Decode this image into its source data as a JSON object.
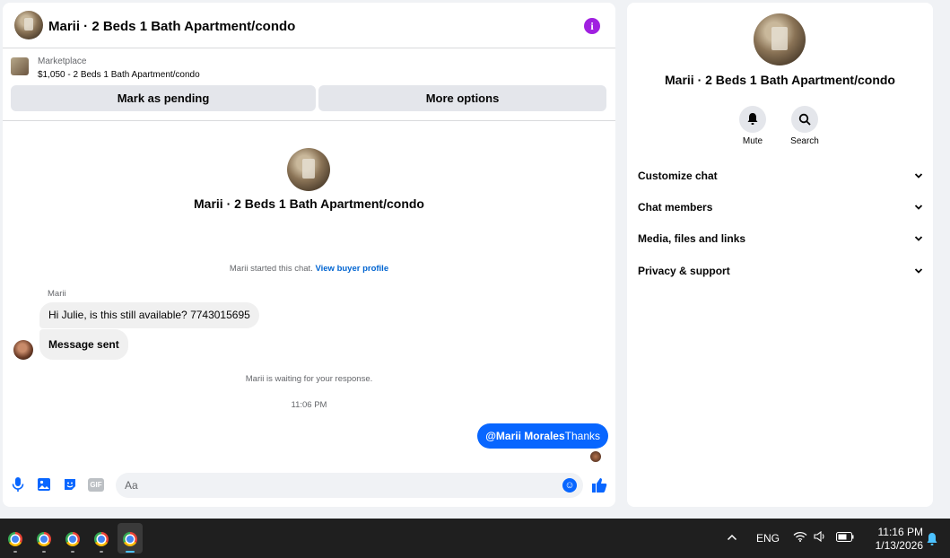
{
  "chat": {
    "title": "Marii · 2 Beds 1 Bath Apartment/condo",
    "listing_source": "Marketplace",
    "listing_detail": "$1,050 - 2 Beds 1 Bath Apartment/condo",
    "mark_pending_label": "Mark as pending",
    "more_options_label": "More options",
    "conversation_title": "Marii · 2 Beds 1 Bath Apartment/condo",
    "started_text": "Marii started this chat.",
    "view_profile_link": "View buyer profile",
    "sender_name": "Marii",
    "messages": [
      {
        "direction": "incoming",
        "text": "Hi Julie, is this still available? 7743015695"
      },
      {
        "direction": "incoming",
        "text": "Message sent"
      }
    ],
    "waiting_text": "Marii is waiting for your response.",
    "timestamp": "11:06 PM",
    "outgoing_mention": "@Marii Morales",
    "outgoing_text": "Thanks",
    "composer_placeholder": "Aa",
    "gif_label": "GIF"
  },
  "info": {
    "title": "Marii · 2 Beds 1 Bath Apartment/condo",
    "mute_label": "Mute",
    "search_label": "Search",
    "sections": [
      {
        "label": "Customize chat"
      },
      {
        "label": "Chat members"
      },
      {
        "label": "Media, files and links"
      },
      {
        "label": "Privacy & support"
      }
    ]
  },
  "taskbar": {
    "apps": [
      "chrome",
      "chrome",
      "chrome",
      "chrome",
      "chrome"
    ],
    "active_app_index": 4,
    "language": "ENG",
    "time": "11:16 PM",
    "date": "1/13/2026"
  },
  "colors": {
    "accent": "#0866ff",
    "info_icon": "#a020e0",
    "button_bg": "#e4e6eb",
    "incoming_bubble": "#f0f0f0",
    "taskbar": "#1f1f1f"
  },
  "icons": [
    "info-icon",
    "mic-icon",
    "photo-icon",
    "sticker-icon",
    "gif-icon",
    "emoji-icon",
    "like-icon",
    "bell-icon",
    "search-icon",
    "chevron-down-icon",
    "wifi-icon",
    "speaker-icon",
    "battery-icon",
    "notification-icon"
  ]
}
